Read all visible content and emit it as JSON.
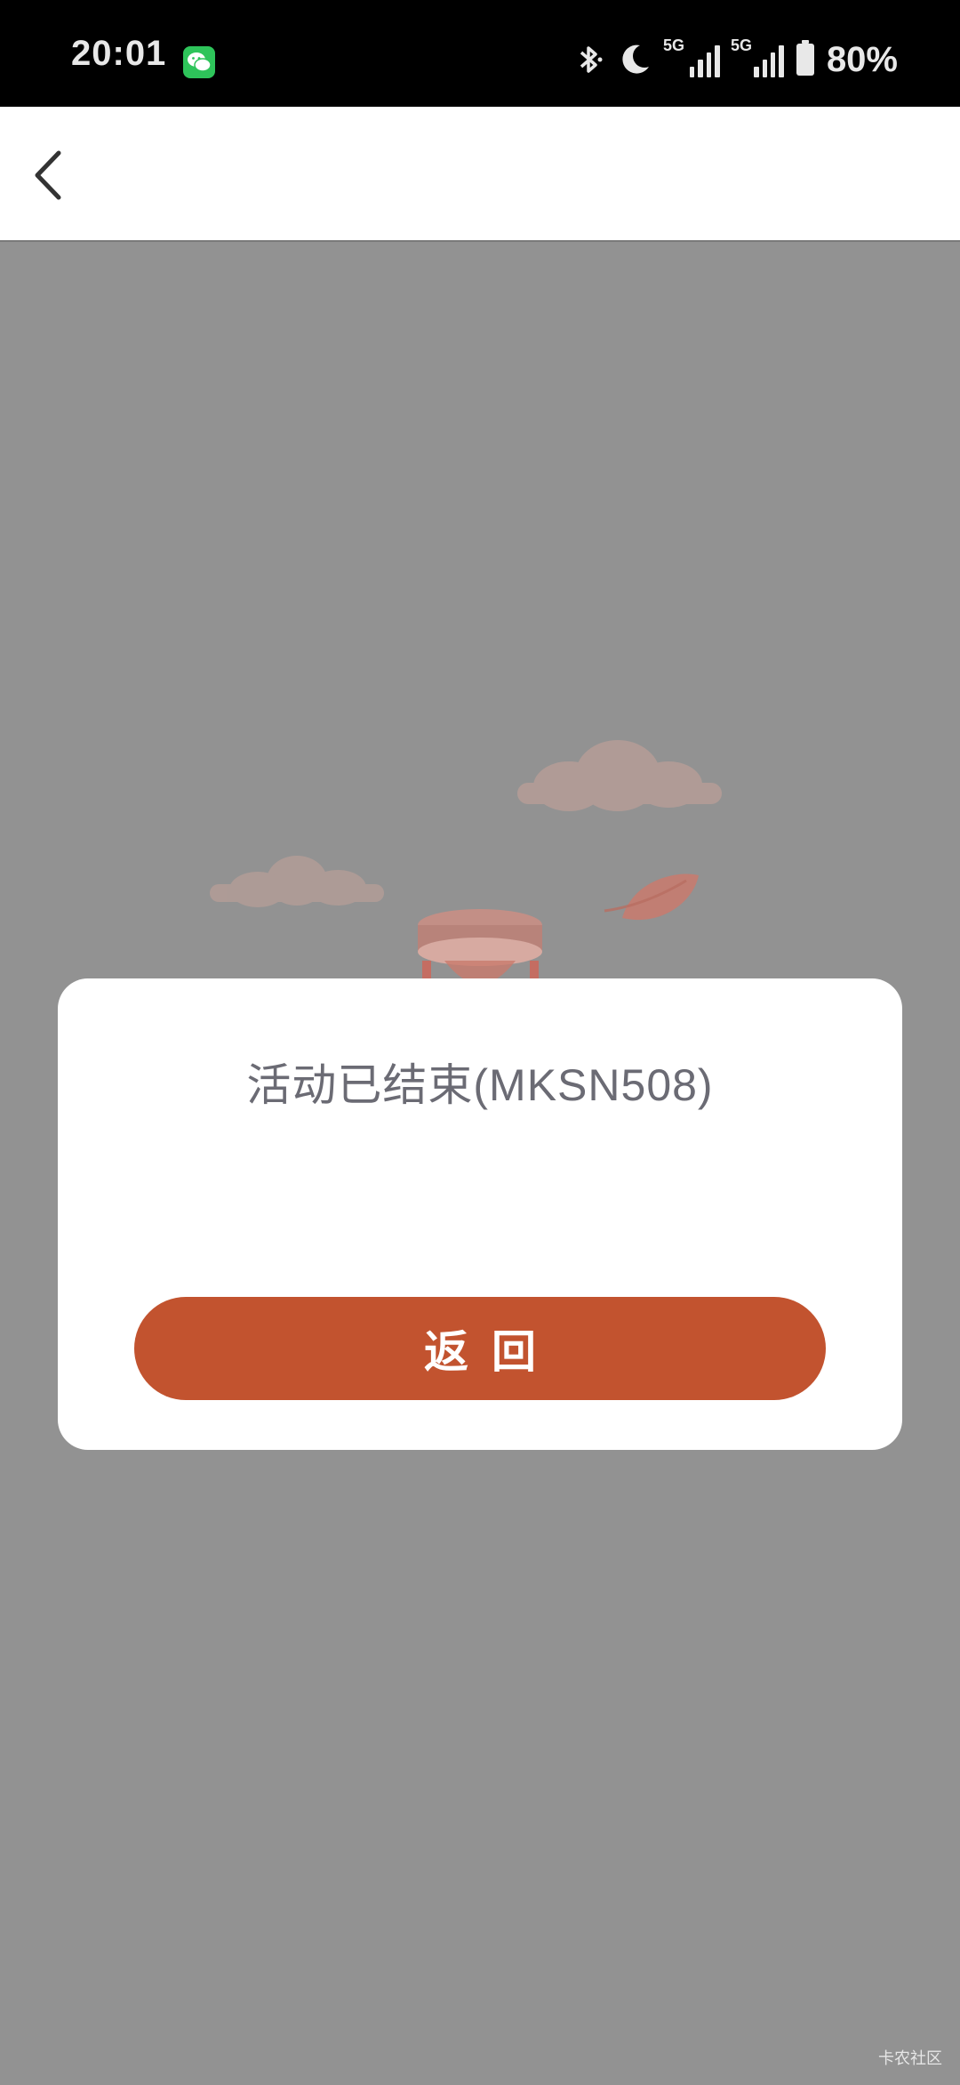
{
  "status_bar": {
    "time": "20:01",
    "battery_percent": "80%",
    "network_tag_1": "5G",
    "network_tag_2": "5G",
    "icons": [
      "wechat-icon",
      "bluetooth-icon",
      "moon-icon",
      "signal-icon",
      "signal-icon",
      "battery-icon"
    ]
  },
  "nav": {
    "back_icon": "chevron-left-icon"
  },
  "dialog": {
    "message": "活动已结束(MKSN508)",
    "button_label": "返回"
  },
  "watermark": "卡农社区",
  "colors": {
    "accent": "#c2532f",
    "overlay": "#929292",
    "message_text": "#6b6b74"
  }
}
